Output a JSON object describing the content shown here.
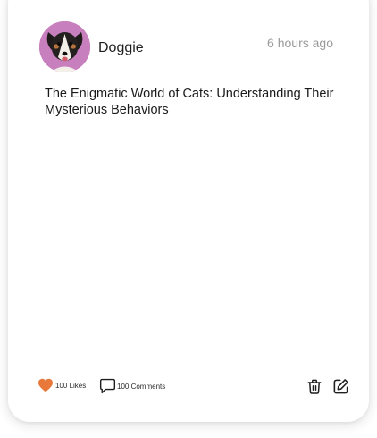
{
  "post": {
    "author": "Doggie",
    "time": "6 hours ago",
    "title": "The Enigmatic World of Cats: Understanding Their Mysterious Behaviors",
    "likes_label": "100 Likes",
    "comments_label": "100 Comments"
  },
  "icons": {
    "like": "heart-icon",
    "comment": "speech-bubble-icon",
    "delete": "trash-icon",
    "edit": "pencil-square-icon"
  },
  "colors": {
    "like_heart": "#e8793a",
    "avatar_background": "#c87fbe",
    "muted_text": "#9a9a9a"
  }
}
